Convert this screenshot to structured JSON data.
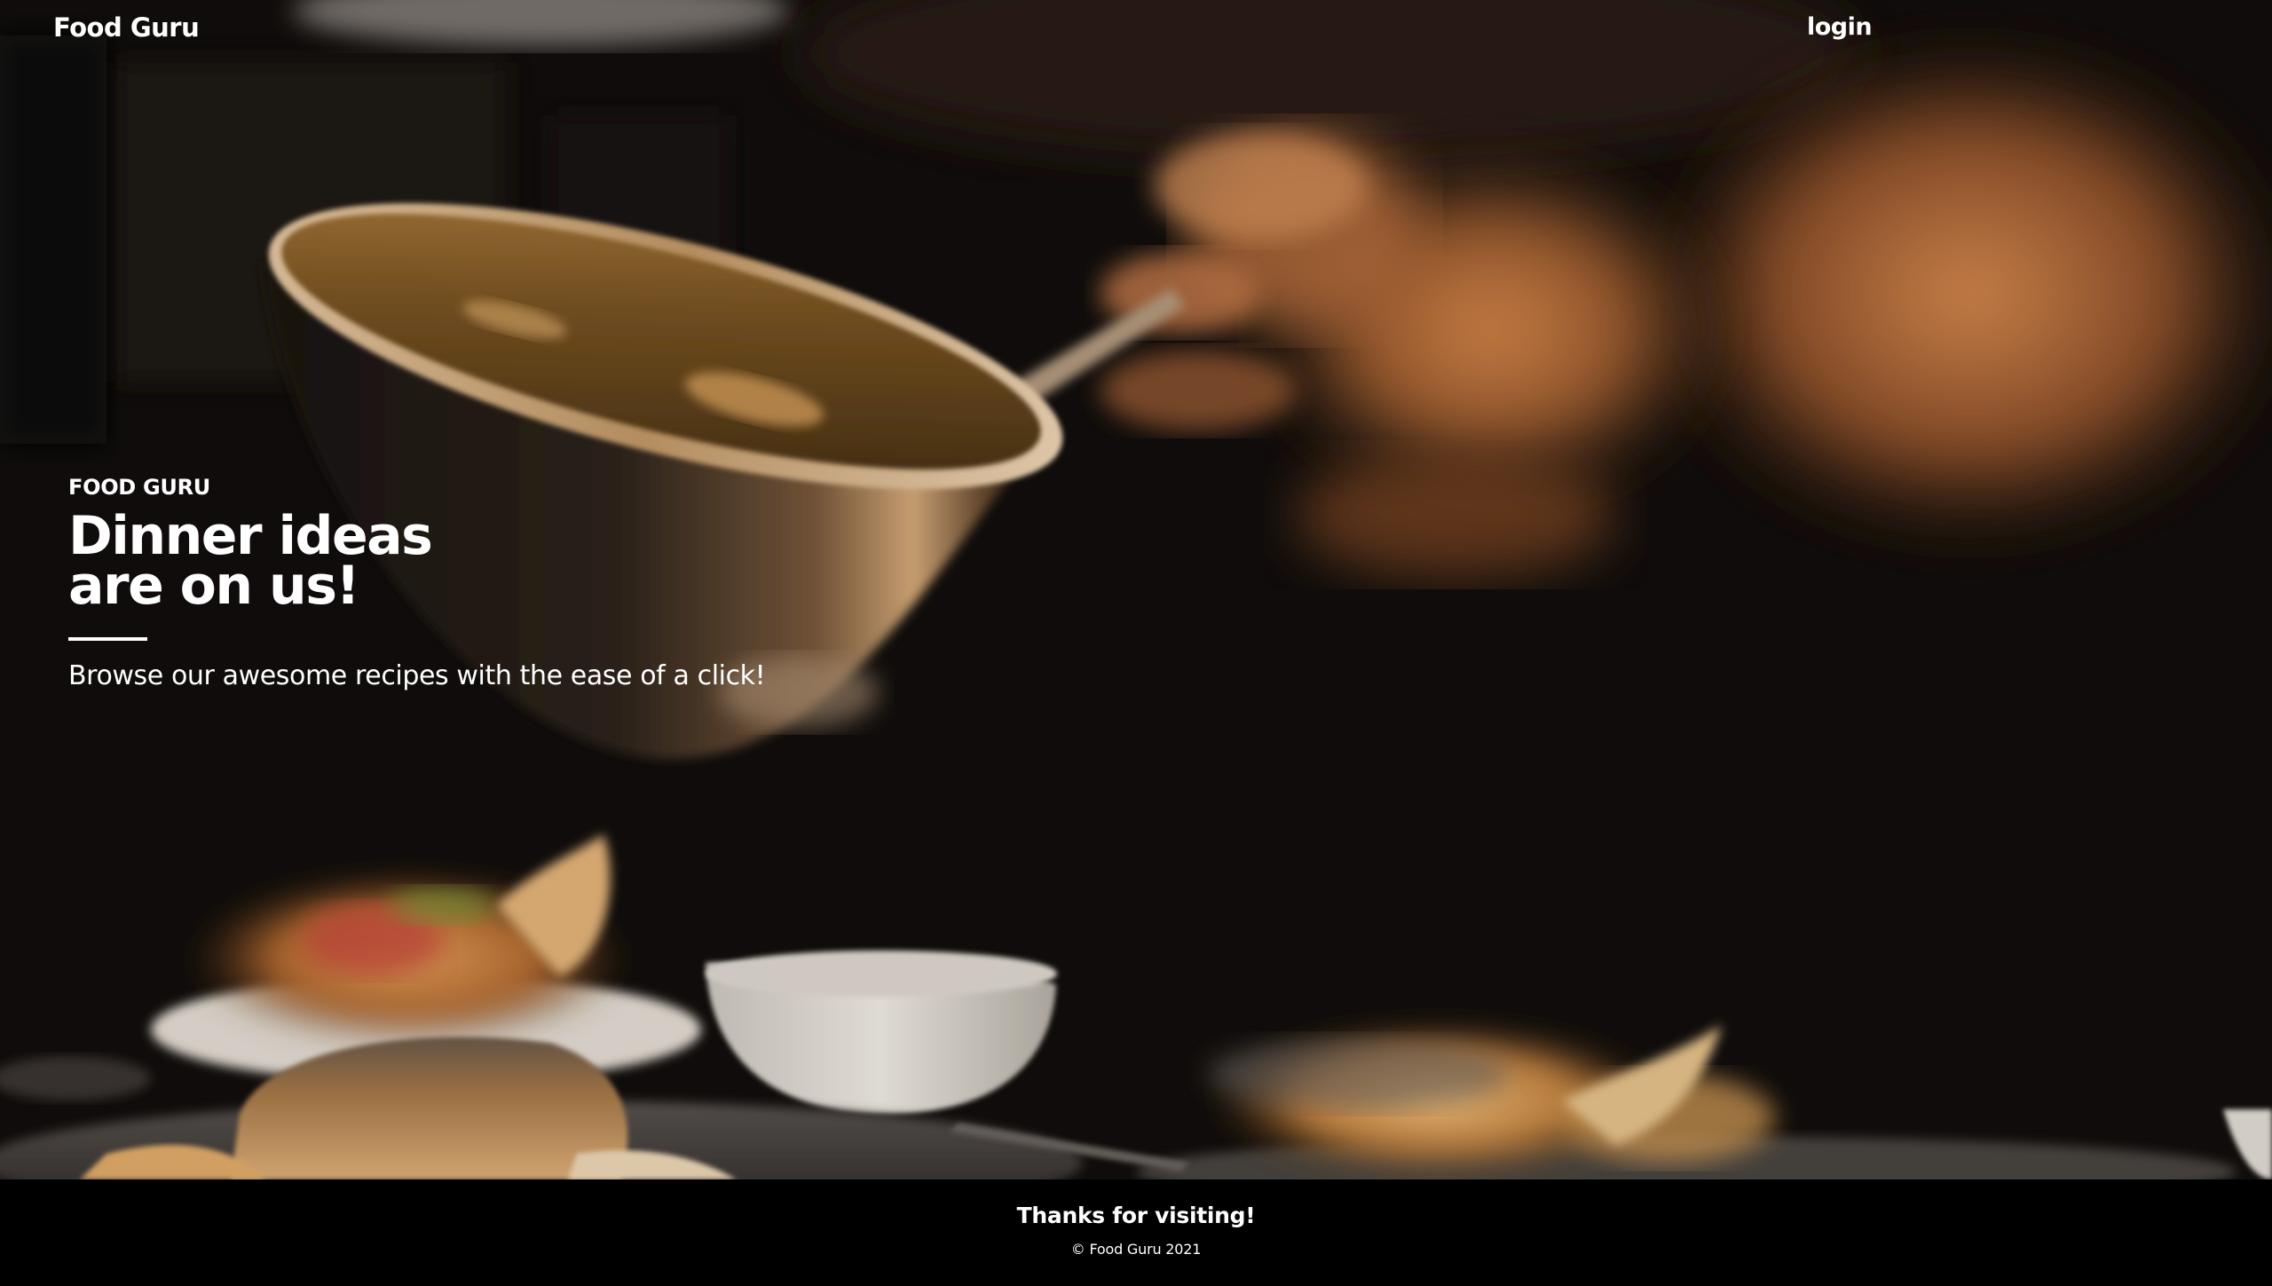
{
  "nav": {
    "brand": "Food Guru",
    "login_label": "login"
  },
  "hero": {
    "eyebrow": "FOOD GURU",
    "headline_line1": "Dinner ideas",
    "headline_line2": "are on us!",
    "tagline": "Browse our awesome recipes with the ease of a click!"
  },
  "footer": {
    "title": "Thanks for visiting!",
    "copyright": "© Food Guru 2021"
  },
  "colors": {
    "background": "#000000",
    "text": "#ffffff",
    "photo_warm_accent": "#c87a43"
  }
}
